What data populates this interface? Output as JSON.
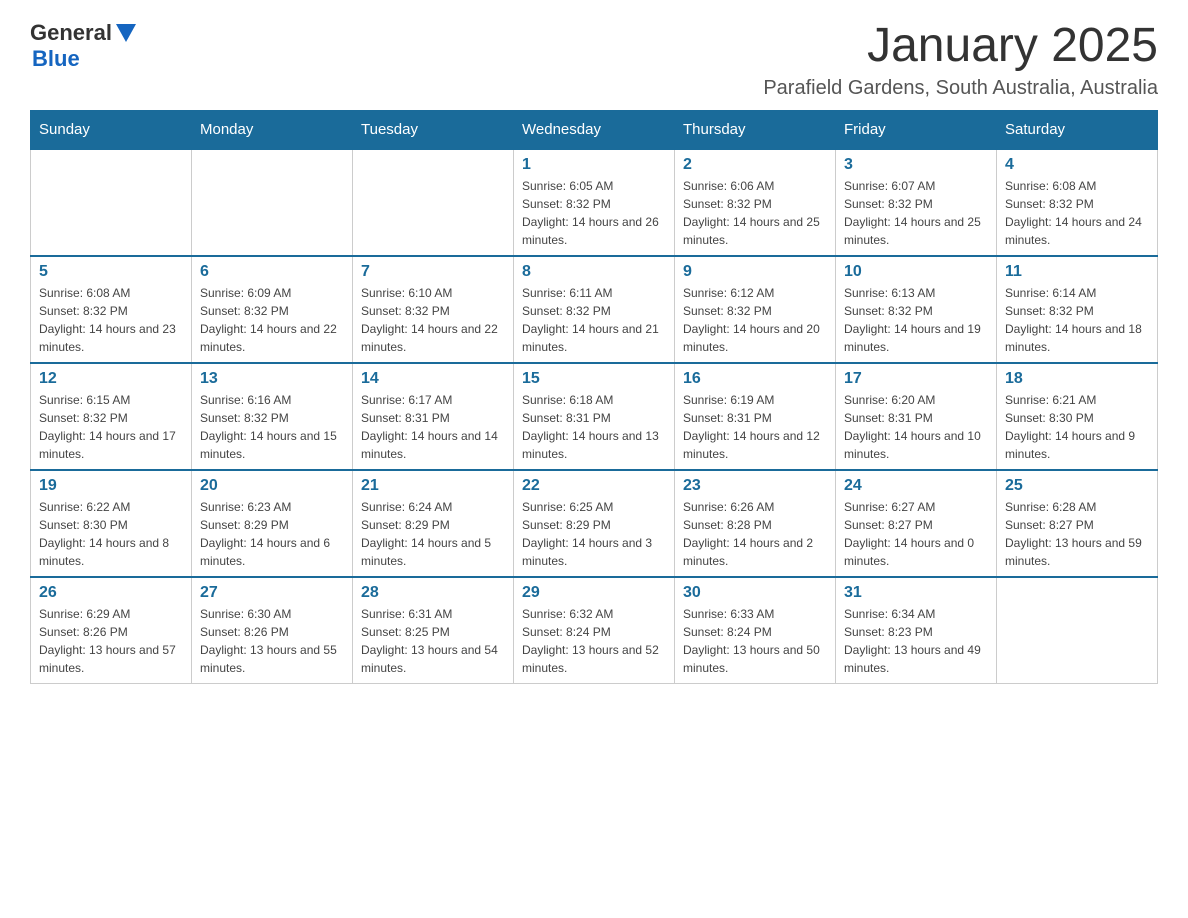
{
  "header": {
    "logo_general": "General",
    "logo_blue": "Blue",
    "month_title": "January 2025",
    "location": "Parafield Gardens, South Australia, Australia"
  },
  "days_of_week": [
    "Sunday",
    "Monday",
    "Tuesday",
    "Wednesday",
    "Thursday",
    "Friday",
    "Saturday"
  ],
  "weeks": [
    [
      {
        "day": "",
        "info": ""
      },
      {
        "day": "",
        "info": ""
      },
      {
        "day": "",
        "info": ""
      },
      {
        "day": "1",
        "info": "Sunrise: 6:05 AM\nSunset: 8:32 PM\nDaylight: 14 hours and 26 minutes."
      },
      {
        "day": "2",
        "info": "Sunrise: 6:06 AM\nSunset: 8:32 PM\nDaylight: 14 hours and 25 minutes."
      },
      {
        "day": "3",
        "info": "Sunrise: 6:07 AM\nSunset: 8:32 PM\nDaylight: 14 hours and 25 minutes."
      },
      {
        "day": "4",
        "info": "Sunrise: 6:08 AM\nSunset: 8:32 PM\nDaylight: 14 hours and 24 minutes."
      }
    ],
    [
      {
        "day": "5",
        "info": "Sunrise: 6:08 AM\nSunset: 8:32 PM\nDaylight: 14 hours and 23 minutes."
      },
      {
        "day": "6",
        "info": "Sunrise: 6:09 AM\nSunset: 8:32 PM\nDaylight: 14 hours and 22 minutes."
      },
      {
        "day": "7",
        "info": "Sunrise: 6:10 AM\nSunset: 8:32 PM\nDaylight: 14 hours and 22 minutes."
      },
      {
        "day": "8",
        "info": "Sunrise: 6:11 AM\nSunset: 8:32 PM\nDaylight: 14 hours and 21 minutes."
      },
      {
        "day": "9",
        "info": "Sunrise: 6:12 AM\nSunset: 8:32 PM\nDaylight: 14 hours and 20 minutes."
      },
      {
        "day": "10",
        "info": "Sunrise: 6:13 AM\nSunset: 8:32 PM\nDaylight: 14 hours and 19 minutes."
      },
      {
        "day": "11",
        "info": "Sunrise: 6:14 AM\nSunset: 8:32 PM\nDaylight: 14 hours and 18 minutes."
      }
    ],
    [
      {
        "day": "12",
        "info": "Sunrise: 6:15 AM\nSunset: 8:32 PM\nDaylight: 14 hours and 17 minutes."
      },
      {
        "day": "13",
        "info": "Sunrise: 6:16 AM\nSunset: 8:32 PM\nDaylight: 14 hours and 15 minutes."
      },
      {
        "day": "14",
        "info": "Sunrise: 6:17 AM\nSunset: 8:31 PM\nDaylight: 14 hours and 14 minutes."
      },
      {
        "day": "15",
        "info": "Sunrise: 6:18 AM\nSunset: 8:31 PM\nDaylight: 14 hours and 13 minutes."
      },
      {
        "day": "16",
        "info": "Sunrise: 6:19 AM\nSunset: 8:31 PM\nDaylight: 14 hours and 12 minutes."
      },
      {
        "day": "17",
        "info": "Sunrise: 6:20 AM\nSunset: 8:31 PM\nDaylight: 14 hours and 10 minutes."
      },
      {
        "day": "18",
        "info": "Sunrise: 6:21 AM\nSunset: 8:30 PM\nDaylight: 14 hours and 9 minutes."
      }
    ],
    [
      {
        "day": "19",
        "info": "Sunrise: 6:22 AM\nSunset: 8:30 PM\nDaylight: 14 hours and 8 minutes."
      },
      {
        "day": "20",
        "info": "Sunrise: 6:23 AM\nSunset: 8:29 PM\nDaylight: 14 hours and 6 minutes."
      },
      {
        "day": "21",
        "info": "Sunrise: 6:24 AM\nSunset: 8:29 PM\nDaylight: 14 hours and 5 minutes."
      },
      {
        "day": "22",
        "info": "Sunrise: 6:25 AM\nSunset: 8:29 PM\nDaylight: 14 hours and 3 minutes."
      },
      {
        "day": "23",
        "info": "Sunrise: 6:26 AM\nSunset: 8:28 PM\nDaylight: 14 hours and 2 minutes."
      },
      {
        "day": "24",
        "info": "Sunrise: 6:27 AM\nSunset: 8:27 PM\nDaylight: 14 hours and 0 minutes."
      },
      {
        "day": "25",
        "info": "Sunrise: 6:28 AM\nSunset: 8:27 PM\nDaylight: 13 hours and 59 minutes."
      }
    ],
    [
      {
        "day": "26",
        "info": "Sunrise: 6:29 AM\nSunset: 8:26 PM\nDaylight: 13 hours and 57 minutes."
      },
      {
        "day": "27",
        "info": "Sunrise: 6:30 AM\nSunset: 8:26 PM\nDaylight: 13 hours and 55 minutes."
      },
      {
        "day": "28",
        "info": "Sunrise: 6:31 AM\nSunset: 8:25 PM\nDaylight: 13 hours and 54 minutes."
      },
      {
        "day": "29",
        "info": "Sunrise: 6:32 AM\nSunset: 8:24 PM\nDaylight: 13 hours and 52 minutes."
      },
      {
        "day": "30",
        "info": "Sunrise: 6:33 AM\nSunset: 8:24 PM\nDaylight: 13 hours and 50 minutes."
      },
      {
        "day": "31",
        "info": "Sunrise: 6:34 AM\nSunset: 8:23 PM\nDaylight: 13 hours and 49 minutes."
      },
      {
        "day": "",
        "info": ""
      }
    ]
  ]
}
